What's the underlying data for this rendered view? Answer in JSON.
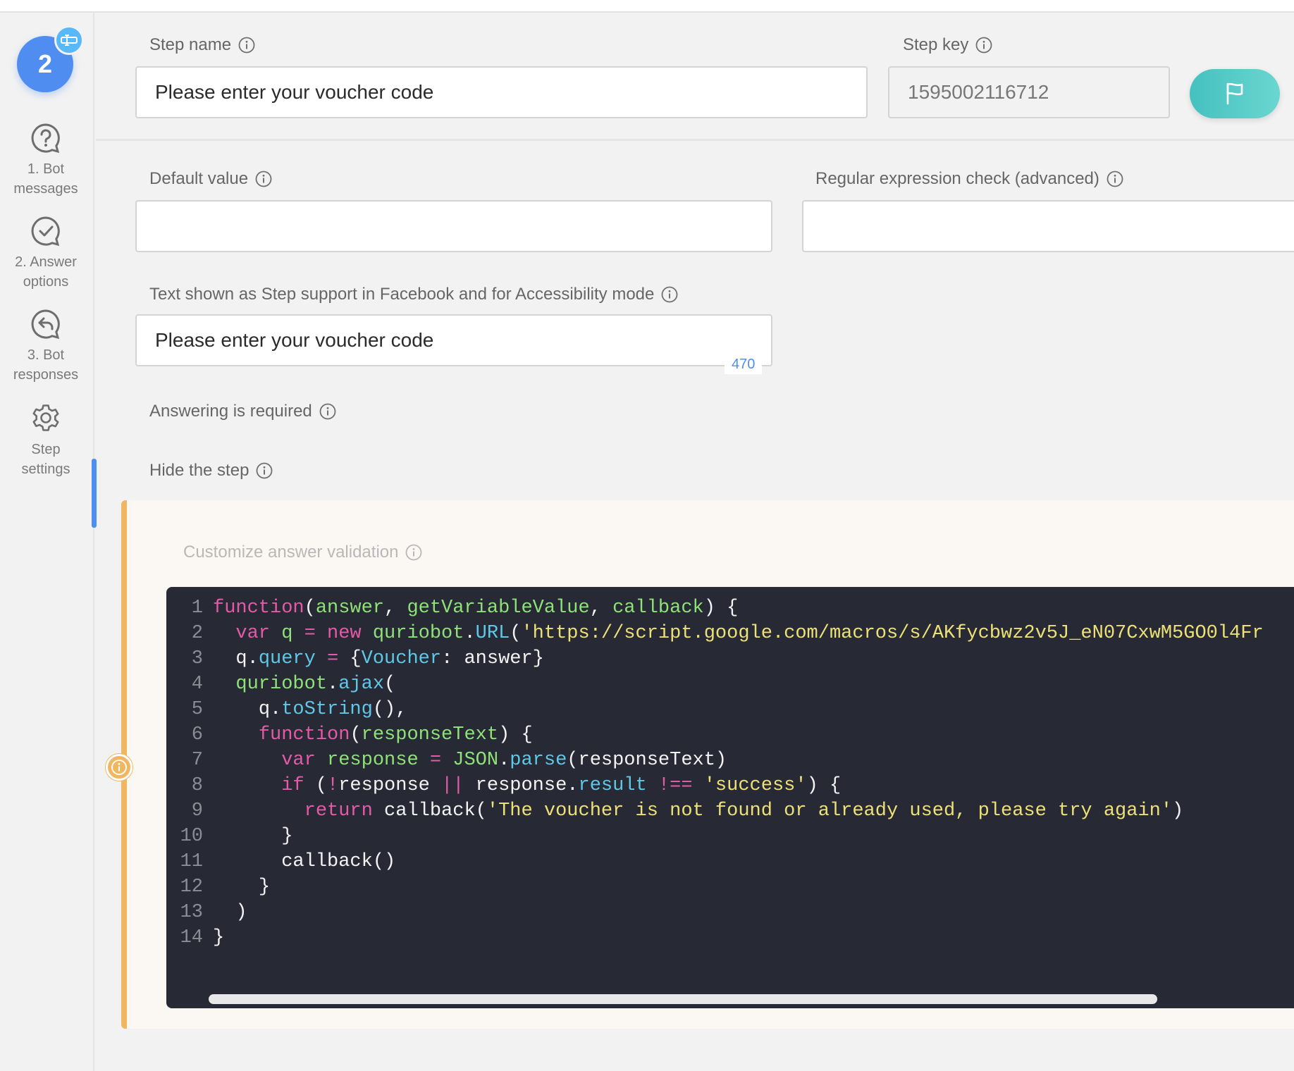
{
  "sidebar": {
    "step_number": "2",
    "items": [
      {
        "label_line1": "1. Bot",
        "label_line2": "messages",
        "icon": "question-bubble-icon"
      },
      {
        "label_line1": "2. Answer",
        "label_line2": "options",
        "icon": "check-bubble-icon"
      },
      {
        "label_line1": "3. Bot",
        "label_line2": "responses",
        "icon": "reply-bubble-icon"
      },
      {
        "label_line1": "Step",
        "label_line2": "settings",
        "icon": "gear-icon",
        "active": true
      }
    ]
  },
  "form": {
    "step_name_label": "Step name",
    "step_name_value": "Please enter your voucher code",
    "step_key_label": "Step key",
    "step_key_value": "1595002116712",
    "default_value_label": "Default value",
    "default_value": "",
    "regex_label": "Regular expression check (advanced)",
    "regex_value": "",
    "support_text_label": "Text shown as Step support in Facebook and for Accessibility mode",
    "support_text_value": "Please enter your voucher code",
    "support_text_counter": "470",
    "required_label": "Answering is required",
    "hide_label": "Hide the step"
  },
  "validation": {
    "label": "Customize answer validation",
    "line_numbers": [
      "1",
      "2",
      "3",
      "4",
      "5",
      "6",
      "7",
      "8",
      "9",
      "10",
      "11",
      "12",
      "13",
      "14"
    ],
    "code": {
      "l1": {
        "kw": "function",
        "p1": "(",
        "a1": "answer",
        "p2": ", ",
        "a2": "getVariableValue",
        "p3": ", ",
        "a3": "callback",
        "p4": ") {"
      },
      "l2": {
        "ind": "  ",
        "kw": "var",
        "v": " q ",
        "op": "=",
        "sp": " ",
        "kw2": "new",
        "fn": " quriobot",
        "dot": ".",
        "prop": "URL",
        "p": "(",
        "str": "'https://script.google.com/macros/s/AKfycbwz2v5J_eN07CxwM5GO0l4Fr"
      },
      "l3": {
        "ind": "  ",
        "v": "q.",
        "prop": "query",
        "sp": " ",
        "op": "=",
        "p": " {",
        "prop2": "Voucher",
        "rest": ": answer}"
      },
      "l4": {
        "ind": "  ",
        "fn": "quriobot",
        "dot": ".",
        "prop": "ajax",
        "p": "("
      },
      "l5": {
        "ind": "    ",
        "v": "q.",
        "prop": "toString",
        "p": "(),"
      },
      "l6": {
        "ind": "    ",
        "kw": "function",
        "p1": "(",
        "a1": "responseText",
        "p2": ") {"
      },
      "l7": {
        "ind": "      ",
        "kw": "var",
        "fn": " response ",
        "op": "=",
        "sp": " ",
        "fn2": "JSON",
        "dot": ".",
        "prop": "parse",
        "rest": "(responseText)"
      },
      "l8": {
        "ind": "      ",
        "kw": "if",
        "p1": " (",
        "op1": "!",
        "v1": "response ",
        "op2": "||",
        "v2": " response.",
        "prop": "result",
        "sp": " ",
        "op3": "!==",
        "sp2": " ",
        "str": "'success'",
        "p2": ") {"
      },
      "l9": {
        "ind": "        ",
        "kw": "return",
        "v": " callback(",
        "str": "'The voucher is not found or already used, please try again'",
        "p": ")"
      },
      "l10": {
        "ind": "      ",
        "p": "}"
      },
      "l11": {
        "ind": "      ",
        "v": "callback()"
      },
      "l12": {
        "ind": "    ",
        "p": "}"
      },
      "l13": {
        "ind": "  ",
        "p": ")"
      },
      "l14": {
        "ind": "",
        "p": "}"
      }
    }
  },
  "colors": {
    "accent_blue": "#4f8ef0",
    "flag_button": "#45c1c0",
    "validation_border": "#f0b762",
    "editor_bg": "#272934"
  }
}
